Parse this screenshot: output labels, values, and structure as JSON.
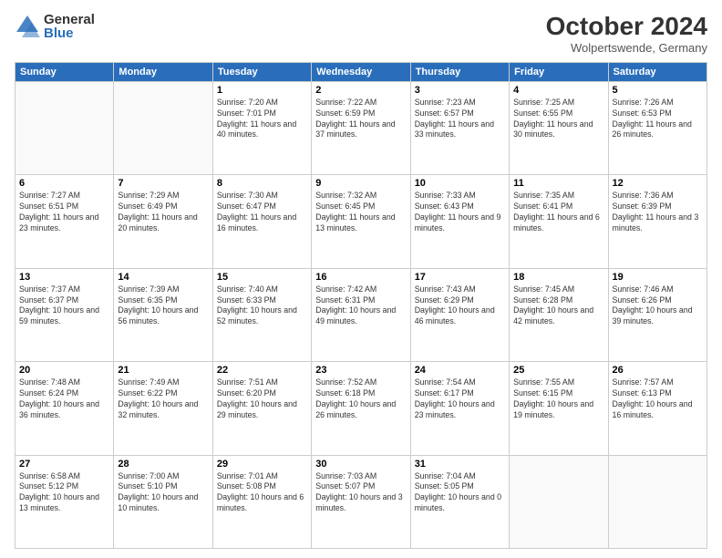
{
  "logo": {
    "general": "General",
    "blue": "Blue"
  },
  "header": {
    "title": "October 2024",
    "subtitle": "Wolpertswende, Germany"
  },
  "days_of_week": [
    "Sunday",
    "Monday",
    "Tuesday",
    "Wednesday",
    "Thursday",
    "Friday",
    "Saturday"
  ],
  "weeks": [
    [
      {
        "day": "",
        "info": ""
      },
      {
        "day": "",
        "info": ""
      },
      {
        "day": "1",
        "info": "Sunrise: 7:20 AM\nSunset: 7:01 PM\nDaylight: 11 hours and 40 minutes."
      },
      {
        "day": "2",
        "info": "Sunrise: 7:22 AM\nSunset: 6:59 PM\nDaylight: 11 hours and 37 minutes."
      },
      {
        "day": "3",
        "info": "Sunrise: 7:23 AM\nSunset: 6:57 PM\nDaylight: 11 hours and 33 minutes."
      },
      {
        "day": "4",
        "info": "Sunrise: 7:25 AM\nSunset: 6:55 PM\nDaylight: 11 hours and 30 minutes."
      },
      {
        "day": "5",
        "info": "Sunrise: 7:26 AM\nSunset: 6:53 PM\nDaylight: 11 hours and 26 minutes."
      }
    ],
    [
      {
        "day": "6",
        "info": "Sunrise: 7:27 AM\nSunset: 6:51 PM\nDaylight: 11 hours and 23 minutes."
      },
      {
        "day": "7",
        "info": "Sunrise: 7:29 AM\nSunset: 6:49 PM\nDaylight: 11 hours and 20 minutes."
      },
      {
        "day": "8",
        "info": "Sunrise: 7:30 AM\nSunset: 6:47 PM\nDaylight: 11 hours and 16 minutes."
      },
      {
        "day": "9",
        "info": "Sunrise: 7:32 AM\nSunset: 6:45 PM\nDaylight: 11 hours and 13 minutes."
      },
      {
        "day": "10",
        "info": "Sunrise: 7:33 AM\nSunset: 6:43 PM\nDaylight: 11 hours and 9 minutes."
      },
      {
        "day": "11",
        "info": "Sunrise: 7:35 AM\nSunset: 6:41 PM\nDaylight: 11 hours and 6 minutes."
      },
      {
        "day": "12",
        "info": "Sunrise: 7:36 AM\nSunset: 6:39 PM\nDaylight: 11 hours and 3 minutes."
      }
    ],
    [
      {
        "day": "13",
        "info": "Sunrise: 7:37 AM\nSunset: 6:37 PM\nDaylight: 10 hours and 59 minutes."
      },
      {
        "day": "14",
        "info": "Sunrise: 7:39 AM\nSunset: 6:35 PM\nDaylight: 10 hours and 56 minutes."
      },
      {
        "day": "15",
        "info": "Sunrise: 7:40 AM\nSunset: 6:33 PM\nDaylight: 10 hours and 52 minutes."
      },
      {
        "day": "16",
        "info": "Sunrise: 7:42 AM\nSunset: 6:31 PM\nDaylight: 10 hours and 49 minutes."
      },
      {
        "day": "17",
        "info": "Sunrise: 7:43 AM\nSunset: 6:29 PM\nDaylight: 10 hours and 46 minutes."
      },
      {
        "day": "18",
        "info": "Sunrise: 7:45 AM\nSunset: 6:28 PM\nDaylight: 10 hours and 42 minutes."
      },
      {
        "day": "19",
        "info": "Sunrise: 7:46 AM\nSunset: 6:26 PM\nDaylight: 10 hours and 39 minutes."
      }
    ],
    [
      {
        "day": "20",
        "info": "Sunrise: 7:48 AM\nSunset: 6:24 PM\nDaylight: 10 hours and 36 minutes."
      },
      {
        "day": "21",
        "info": "Sunrise: 7:49 AM\nSunset: 6:22 PM\nDaylight: 10 hours and 32 minutes."
      },
      {
        "day": "22",
        "info": "Sunrise: 7:51 AM\nSunset: 6:20 PM\nDaylight: 10 hours and 29 minutes."
      },
      {
        "day": "23",
        "info": "Sunrise: 7:52 AM\nSunset: 6:18 PM\nDaylight: 10 hours and 26 minutes."
      },
      {
        "day": "24",
        "info": "Sunrise: 7:54 AM\nSunset: 6:17 PM\nDaylight: 10 hours and 23 minutes."
      },
      {
        "day": "25",
        "info": "Sunrise: 7:55 AM\nSunset: 6:15 PM\nDaylight: 10 hours and 19 minutes."
      },
      {
        "day": "26",
        "info": "Sunrise: 7:57 AM\nSunset: 6:13 PM\nDaylight: 10 hours and 16 minutes."
      }
    ],
    [
      {
        "day": "27",
        "info": "Sunrise: 6:58 AM\nSunset: 5:12 PM\nDaylight: 10 hours and 13 minutes."
      },
      {
        "day": "28",
        "info": "Sunrise: 7:00 AM\nSunset: 5:10 PM\nDaylight: 10 hours and 10 minutes."
      },
      {
        "day": "29",
        "info": "Sunrise: 7:01 AM\nSunset: 5:08 PM\nDaylight: 10 hours and 6 minutes."
      },
      {
        "day": "30",
        "info": "Sunrise: 7:03 AM\nSunset: 5:07 PM\nDaylight: 10 hours and 3 minutes."
      },
      {
        "day": "31",
        "info": "Sunrise: 7:04 AM\nSunset: 5:05 PM\nDaylight: 10 hours and 0 minutes."
      },
      {
        "day": "",
        "info": ""
      },
      {
        "day": "",
        "info": ""
      }
    ]
  ]
}
